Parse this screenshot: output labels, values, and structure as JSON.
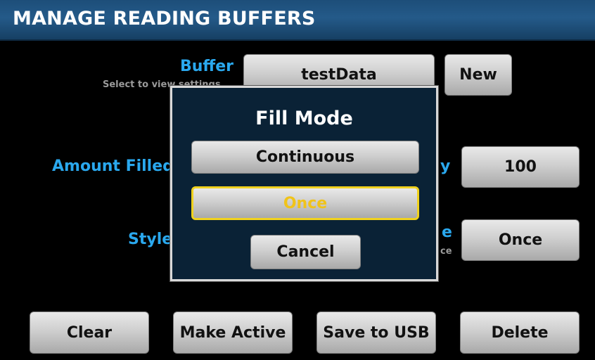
{
  "header": {
    "title": "MANAGE READING BUFFERS"
  },
  "buffer": {
    "label": "Buffer",
    "hint": "Select to view settings",
    "value": "testData",
    "new_label": "New"
  },
  "amount_filled": {
    "label": "Amount Filled"
  },
  "capacity": {
    "label_fragment": "y",
    "value": "100"
  },
  "style": {
    "label": "Style"
  },
  "fill_mode": {
    "label_fragment": "e",
    "hint_fragment": "ce",
    "value": "Once"
  },
  "dialog": {
    "title": "Fill Mode",
    "options": [
      "Continuous",
      "Once"
    ],
    "selected": "Once",
    "cancel_label": "Cancel"
  },
  "footer": {
    "clear_label": "Clear",
    "make_active_label": "Make Active",
    "save_usb_label": "Save to USB",
    "delete_label": "Delete"
  },
  "colors": {
    "title_bar": "#245a89",
    "label_blue": "#2aa8ee",
    "selected_border": "#f0d21e",
    "selected_text": "#f0c31a",
    "dialog_bg": "#0a2236"
  }
}
